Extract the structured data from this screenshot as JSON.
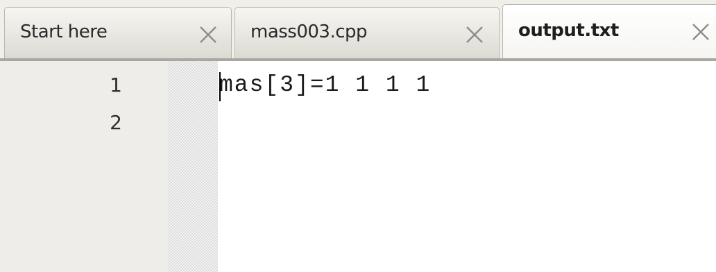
{
  "tabs": [
    {
      "label": "Start here",
      "active": false,
      "close_icon": "close-icon"
    },
    {
      "label": "mass003.cpp",
      "active": false,
      "close_icon": "close-icon"
    },
    {
      "label": "output.txt",
      "active": true,
      "close_icon": "close-icon"
    }
  ],
  "editor": {
    "line_numbers": [
      "1",
      "2"
    ],
    "lines": [
      "mas[3]=1 1 1 1",
      ""
    ]
  },
  "colors": {
    "tabbar_bg": "#f0efe8",
    "gutter_bg": "#eeedea",
    "text": "#1a1a1a"
  }
}
